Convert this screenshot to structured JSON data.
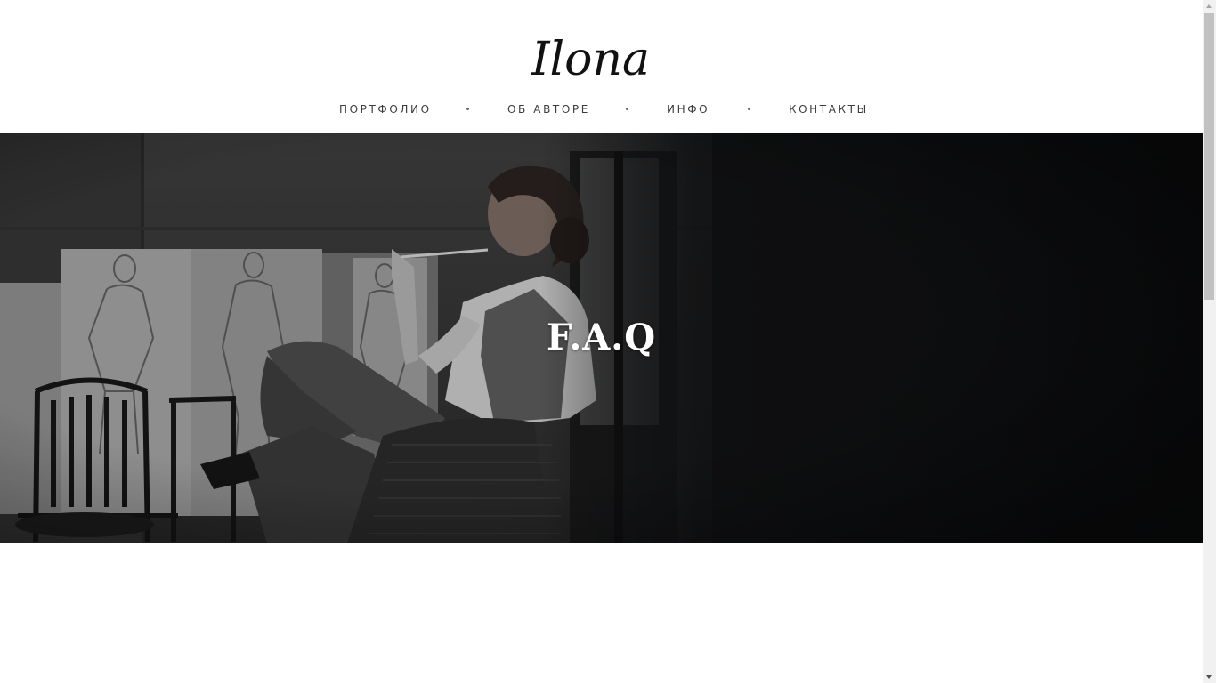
{
  "brand": {
    "logo_text": "Ilona",
    "logo_icon": "script-logo"
  },
  "nav": {
    "items": [
      {
        "label": "ПОРТФОЛИО"
      },
      {
        "label": "ОБ АВТОРЕ"
      },
      {
        "label": "ИНФО"
      },
      {
        "label": "КОНТАКТЫ"
      }
    ],
    "separator": "•"
  },
  "hero": {
    "title": "F.A.Q",
    "image": "black-and-white photo of an artist seated in a wicker chair in a studio with drawings on the wall"
  },
  "colors": {
    "nav_text": "#3c3c3c",
    "hero_dark": "#111214",
    "title": "#ffffff"
  }
}
